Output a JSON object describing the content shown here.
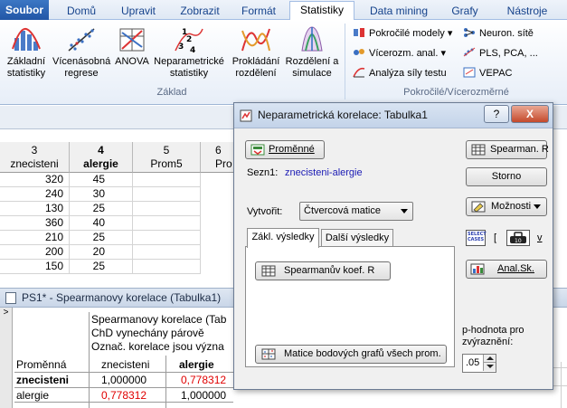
{
  "ribbon": {
    "tabs": [
      "Soubor",
      "Domů",
      "Upravit",
      "Zobrazit",
      "Formát",
      "Statistiky",
      "Data mining",
      "Grafy",
      "Nástroje"
    ],
    "active_tab": "Statistiky",
    "groups": {
      "zaklad": {
        "label": "Základ",
        "buttons": [
          {
            "line1": "Základní",
            "line2": "statistiky"
          },
          {
            "line1": "Vícenásobná",
            "line2": "regrese"
          },
          {
            "line1": "ANOVA",
            "line2": ""
          },
          {
            "line1": "Neparametrické",
            "line2": "statistiky"
          },
          {
            "line1": "Prokládání",
            "line2": "rozdělení"
          },
          {
            "line1": "Rozdělení a",
            "line2": "simulace"
          }
        ]
      },
      "pokrocile": {
        "label": "Pokročilé/Vícerozměrné",
        "items": [
          "Pokročilé modely",
          "Vícerozm. anal.",
          "Analýza síly testu",
          "Neuron. sítě",
          "PLS, PCA, ...",
          "VEPAC"
        ]
      }
    }
  },
  "sheet": {
    "columns": [
      {
        "num": "3",
        "name": "znecisteni",
        "bold": false
      },
      {
        "num": "4",
        "name": "alergie",
        "bold": true
      },
      {
        "num": "5",
        "name": "Prom5",
        "bold": false
      },
      {
        "num": "6",
        "name": "Pro",
        "bold": false
      }
    ],
    "rows": [
      [
        "320",
        "45"
      ],
      [
        "240",
        "30"
      ],
      [
        "130",
        "25"
      ],
      [
        "360",
        "40"
      ],
      [
        "210",
        "25"
      ],
      [
        "200",
        "20"
      ],
      [
        "150",
        "25"
      ]
    ]
  },
  "workbook": {
    "title": "PS1* - Spearmanovy korelace (Tabulka1)",
    "marker": ">",
    "header_lines": [
      "Spearmanovy korelace (Tab",
      "ChD vynechány párově",
      "Označ. korelace jsou význa"
    ],
    "row_label": "Proměnná",
    "col_headers": [
      "znecisteni",
      "alergie"
    ],
    "rows": [
      {
        "name": "znecisteni",
        "v1": "1,000000",
        "v2": "0,778312"
      },
      {
        "name": "alergie",
        "v1": "0,778312",
        "v2": "1,000000"
      }
    ]
  },
  "dialog": {
    "title": "Neparametrická korelace: Tabulka1",
    "help_label": "?",
    "close_label": "X",
    "variables_button": "Proměnné",
    "list_label": "Sezn1:",
    "list_value": "znecisteni-alergie",
    "create_label": "Vytvořit:",
    "create_value": "Čtvercová matice",
    "tabs": [
      "Zákl. výsledky",
      "Další výsledky"
    ],
    "active_tab": "Zákl. výsledky",
    "spearman_coef_button": "Spearmanův koef. R",
    "scatter_matrix_button": "Matice bodových grafů všech prom.",
    "spearman_r_button": "Spearman. R",
    "cancel_button": "Storno",
    "options_button": "Možnosti",
    "select_cases_label": "SELECT CASES",
    "select_cases_suffix": "[",
    "weight_suffix": "v",
    "anal_button": "Anal.Sk.",
    "p_label_line1": "p-hodnota pro",
    "p_label_line2": "zvýraznění:",
    "p_value": ".05"
  }
}
